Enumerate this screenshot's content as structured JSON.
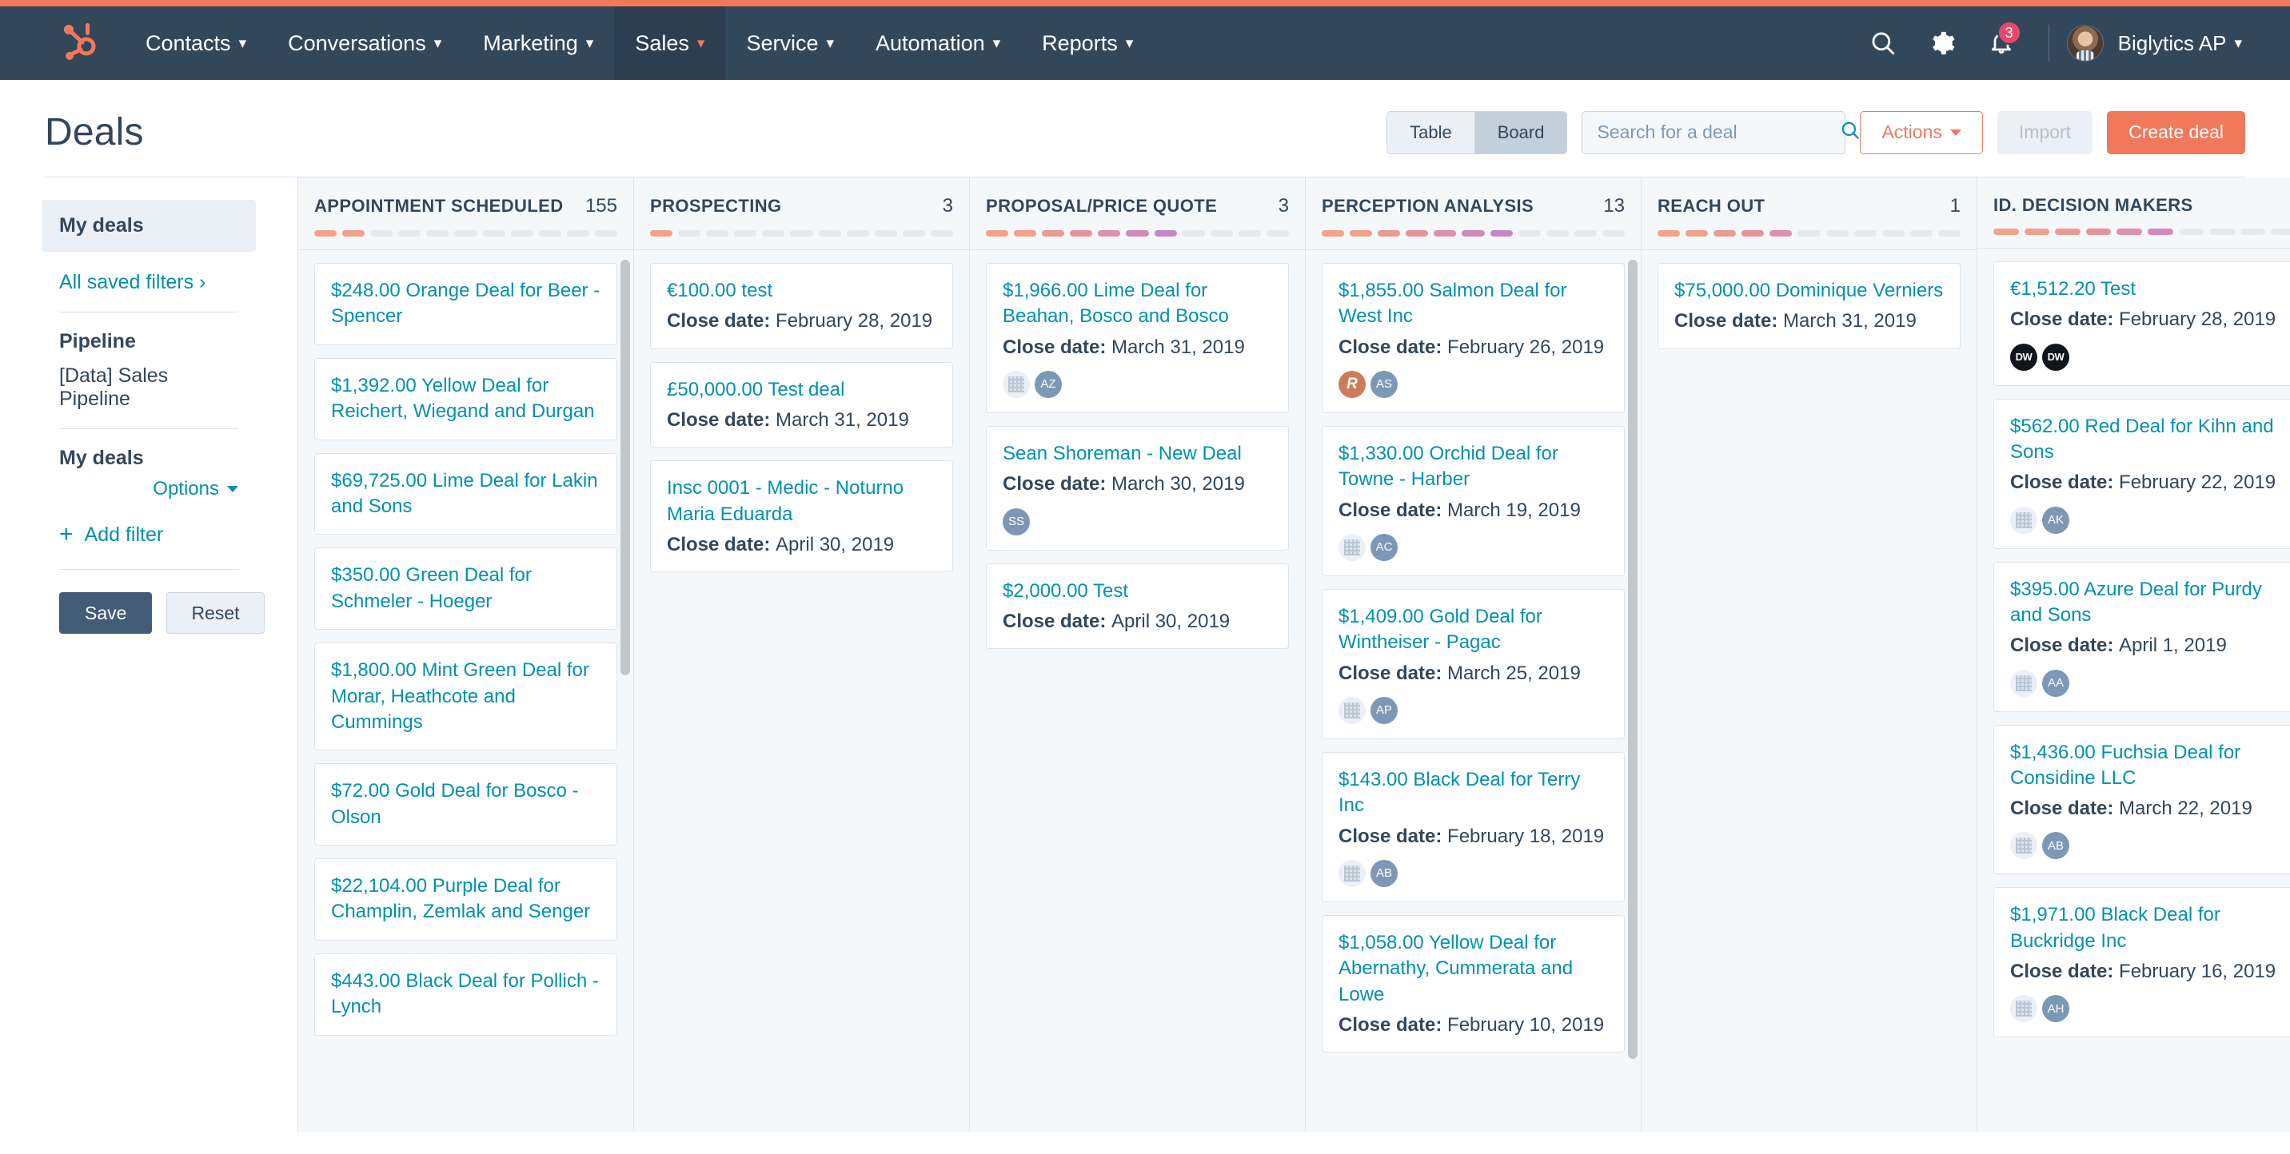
{
  "nav": {
    "logo_icon": "hubspot-sprocket-logo",
    "items": [
      {
        "label": "Contacts",
        "active": false
      },
      {
        "label": "Conversations",
        "active": false
      },
      {
        "label": "Marketing",
        "active": false
      },
      {
        "label": "Sales",
        "active": true
      },
      {
        "label": "Service",
        "active": false
      },
      {
        "label": "Automation",
        "active": false
      },
      {
        "label": "Reports",
        "active": false
      }
    ],
    "search_icon": "search-icon",
    "settings_icon": "gear-icon",
    "notifications_icon": "bell-icon",
    "notifications_count": "3",
    "account_name": "Biglytics AP"
  },
  "header": {
    "title": "Deals",
    "view_table": "Table",
    "view_board": "Board",
    "active_view": "Board",
    "search_placeholder": "Search for a deal",
    "search_value": "",
    "actions_label": "Actions",
    "import_label": "Import",
    "create_label": "Create deal"
  },
  "sidebar": {
    "saved_view": "My deals",
    "all_saved_filters": "All saved filters ",
    "pipeline_label": "Pipeline",
    "pipeline_value": "[Data] Sales Pipeline",
    "my_deals_label": "My deals",
    "options_label": "Options",
    "add_filter_label": "Add filter",
    "save_label": "Save",
    "reset_label": "Reset"
  },
  "board": {
    "date_prefix": "Close date: ",
    "columns": [
      {
        "title": "APPOINTMENT SCHEDULED",
        "count": "155",
        "stages_filled": 2,
        "stages_total": 11,
        "cards": [
          {
            "title": "$248.00 Orange Deal for Beer - Spencer"
          },
          {
            "title": "$1,392.00 Yellow Deal for Reichert, Wiegand and Durgan"
          },
          {
            "title": "$69,725.00 Lime Deal for Lakin and Sons"
          },
          {
            "title": "$350.00 Green Deal for Schmeler - Hoeger"
          },
          {
            "title": "$1,800.00 Mint Green Deal for Morar, Heathcote and Cummings"
          },
          {
            "title": "$72.00 Gold Deal for Bosco - Olson"
          },
          {
            "title": "$22,104.00 Purple Deal for Champlin, Zemlak and Senger"
          },
          {
            "title": "$443.00 Black Deal for Pollich - Lynch"
          }
        ]
      },
      {
        "title": "PROSPECTING",
        "count": "3",
        "stages_filled": 1,
        "stages_total": 11,
        "cards": [
          {
            "title": "€100.00 test",
            "date": "February 28, 2019"
          },
          {
            "title": "£50,000.00 Test deal",
            "date": "March 31, 2019"
          },
          {
            "title": "Insc 0001 - Medic - Noturno Maria Eduarda",
            "date": "April 30, 2019"
          }
        ]
      },
      {
        "title": "PROPOSAL/PRICE QUOTE",
        "count": "3",
        "stages_filled": 7,
        "stages_total": 11,
        "cards": [
          {
            "title": "$1,966.00 Lime Deal for Beahan, Bosco and Bosco",
            "date": "March 31, 2019",
            "avatars": [
              {
                "type": "company"
              },
              {
                "type": "initials",
                "text": "AZ"
              }
            ]
          },
          {
            "title": "Sean Shoreman - New Deal",
            "date": "March 30, 2019",
            "avatars": [
              {
                "type": "initials",
                "text": "SS"
              }
            ]
          },
          {
            "title": "$2,000.00 Test",
            "date": "April 30, 2019"
          }
        ]
      },
      {
        "title": "PERCEPTION ANALYSIS",
        "count": "13",
        "stages_filled": 7,
        "stages_total": 11,
        "cards": [
          {
            "title": "$1,855.00 Salmon Deal for West Inc",
            "date": "February 26, 2019",
            "avatars": [
              {
                "type": "logo-r",
                "text": "R"
              },
              {
                "type": "initials",
                "text": "AS"
              }
            ]
          },
          {
            "title": "$1,330.00 Orchid Deal for Towne - Harber",
            "date": "March 19, 2019",
            "avatars": [
              {
                "type": "company"
              },
              {
                "type": "initials",
                "text": "AC"
              }
            ]
          },
          {
            "title": "$1,409.00 Gold Deal for Wintheiser - Pagac",
            "date": "March 25, 2019",
            "avatars": [
              {
                "type": "company"
              },
              {
                "type": "initials",
                "text": "AP"
              }
            ]
          },
          {
            "title": "$143.00 Black Deal for Terry Inc",
            "date": "February 18, 2019",
            "avatars": [
              {
                "type": "company"
              },
              {
                "type": "initials",
                "text": "AB"
              }
            ]
          },
          {
            "title": "$1,058.00 Yellow Deal for Abernathy, Cummerata and Lowe",
            "date": "February 10, 2019"
          }
        ]
      },
      {
        "title": "REACH OUT",
        "count": "1",
        "stages_filled": 5,
        "stages_total": 11,
        "cards": [
          {
            "title": "$75,000.00 Dominique Verniers",
            "date": "March 31, 2019"
          }
        ]
      },
      {
        "title": "ID. DECISION MAKERS",
        "count": "",
        "stages_filled": 6,
        "stages_total": 10,
        "cards": [
          {
            "title": "€1,512.20 Test",
            "date": "February 28, 2019",
            "avatars": [
              {
                "type": "dw",
                "text": "DW"
              },
              {
                "type": "dw",
                "text": "DW"
              }
            ]
          },
          {
            "title": "$562.00 Red Deal for Kihn and Sons",
            "date": "February 22, 2019",
            "avatars": [
              {
                "type": "company"
              },
              {
                "type": "initials",
                "text": "AK"
              }
            ]
          },
          {
            "title": "$395.00 Azure Deal for Purdy and Sons",
            "date": "April 1, 2019",
            "avatars": [
              {
                "type": "company"
              },
              {
                "type": "initials",
                "text": "AA"
              }
            ]
          },
          {
            "title": "$1,436.00 Fuchsia Deal for Considine LLC",
            "date": "March 22, 2019",
            "avatars": [
              {
                "type": "company"
              },
              {
                "type": "initials",
                "text": "AB"
              }
            ]
          },
          {
            "title": "$1,971.00 Black Deal for Buckridge Inc",
            "date": "February 16, 2019",
            "avatars": [
              {
                "type": "company"
              },
              {
                "type": "initials",
                "text": "AH"
              }
            ]
          }
        ]
      }
    ]
  },
  "colors": {
    "nav_bg": "#33475b",
    "accent": "#f2785c",
    "link": "#0091ae",
    "badge": "#e8486b",
    "board_bg": "#f5f8fa",
    "stage_start": "#f5a287",
    "stage_end": "#bf83bf"
  }
}
